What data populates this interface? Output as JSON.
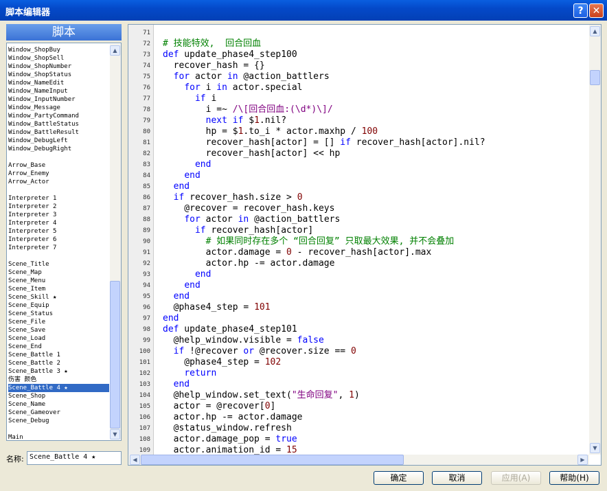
{
  "window": {
    "title": "脚本编辑器",
    "help_glyph": "?",
    "close_glyph": "✕"
  },
  "sidebar": {
    "header": "脚本",
    "items": [
      "Window_ShopBuy",
      "Window_ShopSell",
      "Window_ShopNumber",
      "Window_ShopStatus",
      "Window_NameEdit",
      "Window_NameInput",
      "Window_InputNumber",
      "Window_Message",
      "Window_PartyCommand",
      "Window_BattleStatus",
      "Window_BattleResult",
      "Window_DebugLeft",
      "Window_DebugRight",
      "",
      "Arrow_Base",
      "Arrow_Enemy",
      "Arrow_Actor",
      "",
      "Interpreter 1",
      "Interpreter 2",
      "Interpreter 3",
      "Interpreter 4",
      "Interpreter 5",
      "Interpreter 6",
      "Interpreter 7",
      "",
      "Scene_Title",
      "Scene_Map",
      "Scene_Menu",
      "Scene_Item",
      "Scene_Skill ★",
      "Scene_Equip",
      "Scene_Status",
      "Scene_File",
      "Scene_Save",
      "Scene_Load",
      "Scene_End",
      "Scene_Battle 1",
      "Scene_Battle 2",
      "Scene_Battle 3 ★",
      "伤害 颜色",
      "Scene_Battle 4 ★",
      "Scene_Shop",
      "Scene_Name",
      "Scene_Gameover",
      "Scene_Debug",
      "",
      "Main"
    ],
    "selected_index": 41
  },
  "name_field": {
    "label": "名称:",
    "value": "Scene_Battle 4 ★"
  },
  "editor": {
    "line_numbers": [
      "71",
      "72",
      "73",
      "74",
      "75",
      "76",
      "77",
      "78",
      "79",
      "80",
      "81",
      "82",
      "83",
      "84",
      "85",
      "86",
      "87",
      "88",
      "89",
      "90",
      "91",
      "92",
      "93",
      "94",
      "95",
      "96",
      "97",
      "98",
      "99",
      "100",
      "101",
      "102",
      "103",
      "104",
      "105",
      "106",
      "107",
      "108",
      "109"
    ],
    "lines": [
      "",
      "# 技能特效,  回合回血",
      "def update_phase4_step100",
      "  recover_hash = {}",
      "  for actor in @action_battlers",
      "    for i in actor.special",
      "      if i",
      "        i =~ /\\[回合回血:(\\d*)\\]/",
      "        next if $1.nil?",
      "        hp = $1.to_i * actor.maxhp / 100",
      "        recover_hash[actor] = [] if recover_hash[actor].nil?",
      "        recover_hash[actor] << hp",
      "      end",
      "    end",
      "  end",
      "  if recover_hash.size > 0",
      "    @recover = recover_hash.keys",
      "    for actor in @action_battlers",
      "      if recover_hash[actor]",
      "        # 如果同时存在多个 “回合回复” 只取最大效果, 并不会叠加",
      "        actor.damage = 0 - recover_hash[actor].max",
      "        actor.hp -= actor.damage",
      "      end",
      "    end",
      "  end",
      "  @phase4_step = 101",
      "end",
      "def update_phase4_step101",
      "  @help_window.visible = false",
      "  if !@recover or @recover.size == 0",
      "    @phase4_step = 102",
      "    return",
      "  end",
      "  @help_window.set_text(\"生命回复\", 1)",
      "  actor = @recover[0]",
      "  actor.hp -= actor.damage",
      "  @status_window.refresh",
      "  actor.damage_pop = true",
      "  actor.animation_id = 15"
    ]
  },
  "buttons": {
    "ok": "确定",
    "cancel": "取消",
    "apply": "应用(A)",
    "help": "帮助(H)"
  },
  "icons": {
    "up": "▲",
    "down": "▼",
    "left": "◀",
    "right": "▶",
    "grip": "≡"
  }
}
